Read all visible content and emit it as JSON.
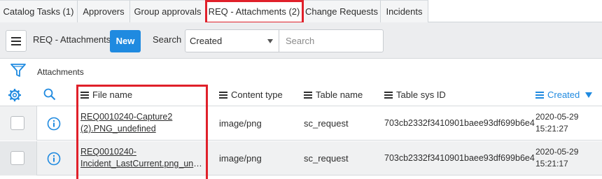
{
  "tabs": [
    {
      "label": "Catalog Tasks (1)"
    },
    {
      "label": "Approvers"
    },
    {
      "label": "Group approvals"
    },
    {
      "label": "REQ - Attachments (2)"
    },
    {
      "label": "Change Requests"
    },
    {
      "label": "Incidents"
    }
  ],
  "listbar": {
    "title": "REQ - Attachments",
    "new_label": "New",
    "search_label": "Search",
    "search_field": "Created",
    "search_placeholder": "Search"
  },
  "breadcrumb": {
    "text": "Attachments"
  },
  "columns": {
    "file_name": "File name",
    "content_type": "Content type",
    "table_name": "Table name",
    "table_sys_id": "Table sys ID",
    "created": "Created"
  },
  "rows": [
    {
      "file_name_line1": "REQ0010240-Capture2",
      "file_name_line2": "(2).PNG_undefined",
      "content_type": "image/png",
      "table_name": "sc_request",
      "table_sys_id": "703cb2332f3410901baee93df699b6e4",
      "created_date": "2020-05-29",
      "created_time": "15:21:27"
    },
    {
      "file_name_line1": "REQ0010240-",
      "file_name_line2": "Incident_LastCurrent.png_unde…",
      "content_type": "image/png",
      "table_name": "sc_request",
      "table_sys_id": "703cb2332f3410901baee93df699b6e4",
      "created_date": "2020-05-29",
      "created_time": "15:21:17"
    }
  ],
  "colors": {
    "accent": "#1f8ae0",
    "highlight": "#e0202a"
  }
}
